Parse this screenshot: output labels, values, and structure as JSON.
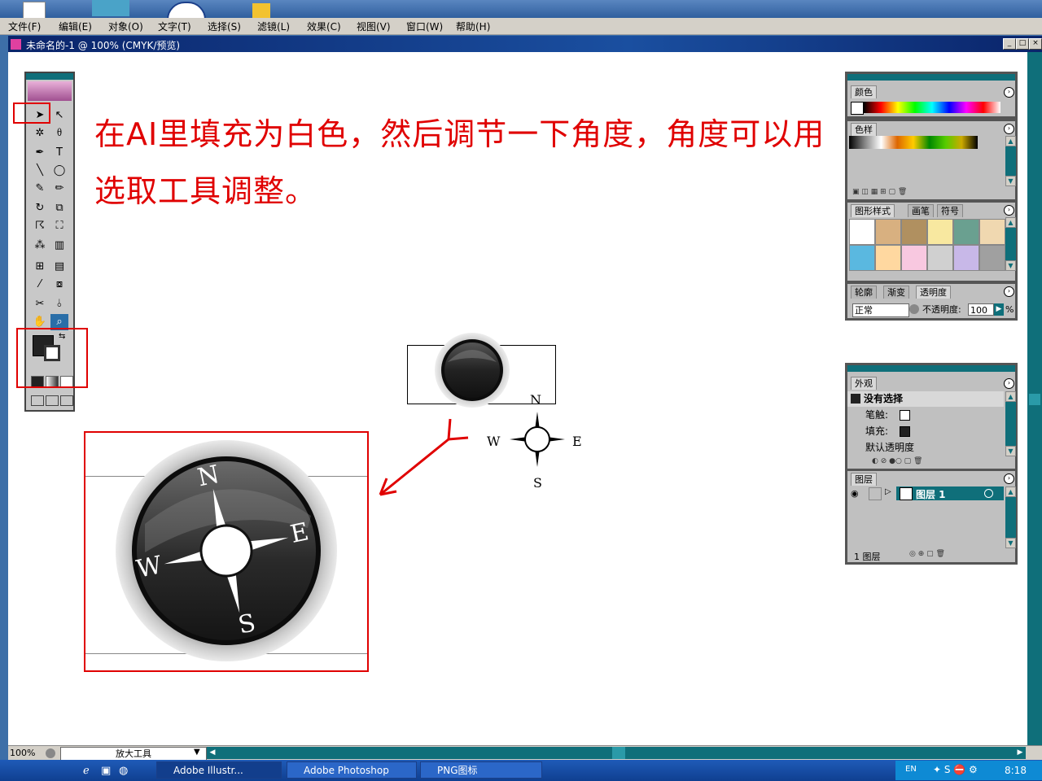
{
  "menu": [
    "文件(F)",
    "编辑(E)",
    "对象(O)",
    "文字(T)",
    "选择(S)",
    "滤镜(L)",
    "效果(C)",
    "视图(V)",
    "窗口(W)",
    "帮助(H)"
  ],
  "document": {
    "title": "未命名的-1 @ 100% (CMYK/预览)"
  },
  "annotation": {
    "line1": "在AI里填充为白色，然后调节一下角度，角度可以用",
    "line2": "选取工具调整。"
  },
  "compass_small": {
    "n": "N",
    "s": "S",
    "e": "E",
    "w": "W"
  },
  "compass_large": {
    "n": "N",
    "s": "S",
    "e": "E",
    "w": "W"
  },
  "panel_color": {
    "tab": "颜色"
  },
  "panel_swatches": {
    "tab": "色样"
  },
  "panel_styles": {
    "tabs": [
      "图形样式",
      "画笔",
      "符号"
    ]
  },
  "panel_transparency": {
    "tabs": [
      "轮廓",
      "渐变",
      "透明度"
    ],
    "blend_mode": "正常",
    "opacity_label": "不透明度:",
    "opacity_value": "100",
    "unit": "%"
  },
  "panel_appearance": {
    "tab": "外观",
    "selection": "没有选择",
    "stroke": "笔触:",
    "fill": "填充:",
    "opacity": "默认透明度"
  },
  "panel_layers": {
    "tab": "图层",
    "layer_name": "图层 1",
    "footer": "1 图层"
  },
  "status": {
    "zoom": "100%",
    "tool": "放大工具"
  },
  "taskbar": {
    "items": [
      "Adobe Illustr...",
      "Adobe Photoshop",
      "PNG图标"
    ],
    "lang": "EN",
    "time": "8:18"
  }
}
